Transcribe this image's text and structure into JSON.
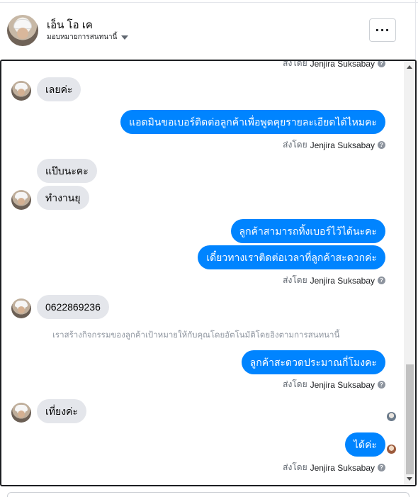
{
  "header": {
    "name": "เอ็น โอ เค",
    "assign_label": "มอบหมายการสนทนานี้",
    "more_label": "···"
  },
  "chat": {
    "top_partial_sender": {
      "prefix": "ส่งโดย",
      "name": "Jenjira Suksabay"
    },
    "messages": [
      {
        "id": "m1",
        "dir": "in",
        "text": "เลยค่ะ"
      },
      {
        "id": "m2",
        "dir": "out",
        "text": "แอดมินขอเบอร์ติดต่อลูกค้าเพื่อพูดคุยรายละเอียดได้ไหมคะ"
      },
      {
        "id": "m3",
        "dir": "in",
        "text": "แป๊บนะคะ"
      },
      {
        "id": "m4",
        "dir": "in",
        "text": "ทำงานยุ"
      },
      {
        "id": "m5",
        "dir": "out",
        "text": "ลูกค้าสามารถทิ้งเบอร์ไว้ได้นะคะ"
      },
      {
        "id": "m6",
        "dir": "out",
        "text": "เดี๋ยวทางเราติดต่อเวลาที่ลูกค้าสะดวกค่ะ"
      },
      {
        "id": "m7",
        "dir": "in",
        "text": "0622869236"
      },
      {
        "id": "m8",
        "dir": "out",
        "text": "ลูกค้าสะดวดประมาณกี่โมงคะ"
      },
      {
        "id": "m9",
        "dir": "in",
        "text": "เที่ยงค่ะ"
      },
      {
        "id": "m10",
        "dir": "out",
        "text": "ได้ค่ะ"
      }
    ],
    "sent_by": {
      "prefix": "ส่งโดย",
      "name": "Jenjira Suksabay"
    },
    "system_note": "เราสร้างกิจกรรมของลูกค้าเป้าหมายให้กับคุณโดยอัตโนมัติโดยอิงตามการสนทนานี้"
  },
  "icons": {
    "info": "question-circle-icon",
    "caret": "caret-down-icon",
    "more": "more-horizontal-icon"
  },
  "colors": {
    "outgoing_bubble": "#0084ff",
    "incoming_bubble": "#e4e6eb",
    "meta_text": "#606770"
  }
}
